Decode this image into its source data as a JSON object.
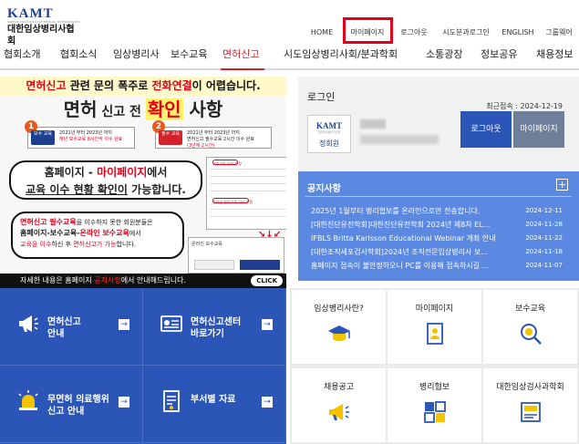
{
  "site": {
    "logo_mark": "KAMT",
    "logo_sub": "KOREAN ASSOCIATION OF MEDICAL TECHNOLOGISTS",
    "name": "대한임상병리사협회"
  },
  "topnav": [
    "HOME",
    "마이페이지",
    "로그아웃",
    "시도분과로그인",
    "ENGLISH",
    "그룹웨어"
  ],
  "mainnav": [
    "협회소개",
    "협회소식",
    "임상병리사",
    "보수교육",
    "면허신고",
    "시도임상병리사회/분과학회",
    "소통광장",
    "정보공유",
    "채용정보"
  ],
  "banner": {
    "head_a": "면허신고",
    "head_b": " 관련 문의 폭주로 ",
    "head_c": "전화연결",
    "head_d": "이 어렵습니다.",
    "title_a": "면허",
    "title_b": " 신고 전 ",
    "title_c": "확인",
    "title_d": " 사항",
    "step1": {
      "num": "1",
      "tag": "보수\n교육",
      "line1": "2021년 부터 2023년 까지",
      "line2": "해년 보수교육 8시간씩 이수 완료"
    },
    "step2": {
      "num": "2",
      "tag": "필수\n교육",
      "line1": "2021년 부터 2023년 까지",
      "line2": "면허신고 필수교육 2시간 이수 완료",
      "line3": "(3년에 2시간)"
    },
    "bubble1_a": "홈페이지 - ",
    "bubble1_b": "마이페이지",
    "bubble1_c": "에서",
    "bubble1_d": "교육 이수 현황 확인이",
    "bubble1_e": " 가능합니다.",
    "shot_label": "보수교육 이수 현황",
    "shot_label2": "온라인 필수교육 이수 현황",
    "bubble2_a": "면허신고 필수교육",
    "bubble2_b": "을 이수하지 못한 회원분들은",
    "bubble2_c": "홈페이지-보수교육-",
    "bubble2_d": "온라인 보수교육",
    "bubble2_e": "에서",
    "bubble2_f": "교육을 이수",
    "bubble2_g": "하신 후 ",
    "bubble2_h": "면허신고가 가능",
    "bubble2_i": "합니다.",
    "shot2_title": "온라인 보수교육",
    "foot_a": "자세한 내용은 홈페이지 ",
    "foot_b": "공지사항",
    "foot_c": "에서 안내해드립니다.",
    "click": "CLICK"
  },
  "login": {
    "heading": "로그인",
    "last_access": "최근접속 : 2024-12-19",
    "role": "정회원",
    "logout": "로그아웃",
    "mypage": "마이페이지"
  },
  "notice": {
    "heading": "공지사항",
    "plus": "+",
    "items": [
      {
        "title": "2025년 1월부터 병리협보를 온라인으로만 전송합니다.",
        "date": "2024-12-11"
      },
      {
        "title": "[대한진단유전학회]대한진단유전학회 2024년 제8차 EL...",
        "date": "2024-11-28"
      },
      {
        "title": "IFBLS Britta Karlsson Educational Webinar 개최 안내",
        "date": "2024-11-22"
      },
      {
        "title": "[대한조직세포검사학회]2024년 조직전문임상병리사 보...",
        "date": "2024-11-18"
      },
      {
        "title": "홈페이지 접속이 불안정하오니 PC를 이용해 접속하시길 ...",
        "date": "2024-11-07"
      }
    ]
  },
  "tiles": [
    {
      "l1": "면허신고",
      "l2": "안내",
      "icon": "megaphone-icon"
    },
    {
      "l1": "면허신고센터",
      "l2": "바로가기",
      "icon": "license-card-icon"
    },
    {
      "l1": "무면허 의료행위",
      "l2": "신고 안내",
      "icon": "siren-icon"
    },
    {
      "l1": "부서별 자료",
      "l2": "",
      "icon": "document-icon"
    }
  ],
  "quick": [
    {
      "label": "임상병리사란?",
      "icon": "graduation-cap-icon"
    },
    {
      "label": "마이페이지",
      "icon": "profile-document-icon"
    },
    {
      "label": "보수교육",
      "icon": "search-education-icon"
    },
    {
      "label": "채용공고",
      "icon": "megaphone-icon"
    },
    {
      "label": "병리협보",
      "icon": "grid-layout-icon"
    },
    {
      "label": "대한임상검사과학회",
      "icon": "journal-icon"
    }
  ],
  "colors": {
    "primary": "#2b55b7",
    "accent": "#d2232a",
    "notice": "#5b88e0",
    "highlight": "#e10019"
  }
}
